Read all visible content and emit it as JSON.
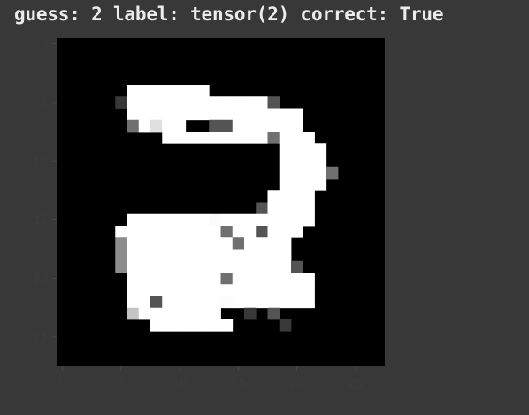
{
  "output": {
    "title": "guess: 2 label: tensor(2) correct: True"
  },
  "image_plot": {
    "type": "heatmap",
    "colormap": "gray",
    "rows": 28,
    "cols": 28,
    "x_ticks": [
      "0",
      "5",
      "10",
      "15",
      "20",
      "25"
    ],
    "y_ticks": [
      "0",
      "5",
      "10",
      "15",
      "20",
      "25"
    ],
    "pixels": [
      "............................",
      "............................",
      "............................",
      "............................",
      "......TTTTTTT...............",
      ".....2TTTTTTTTTTTT3.........",
      "......TTTTTTTTTTTTTTT.......",
      "......4T8TT..33TTTTTT.......",
      ".........TTTTTTTTT4TTT......",
      "...................TTTT.....",
      "...................TTTT.....",
      "...................TTTT4....",
      "...................TTTT.....",
      "..................TTTT......",
      ".................3TTTT......",
      "......TTTTTTT9TTTTTTTT......",
      ".....TTTTTTTTT4TT3TTT.......",
      ".....5TTTTTTTTT4TTTT........",
      ".....5TTTTTTTTTTTTTT........",
      ".....5TTTTTTTTTTTTTT3.......",
      "......TTTTTTTT4TTTTTTT......",
      "......TTTTTTTTTTTTTTTT......",
      "......TT3TTTTT9TTTTTTT......",
      "......7TTTTTTT..2.3.........",
      "........TTTTTTT....2........",
      "............................",
      "............................",
      "............................"
    ]
  }
}
